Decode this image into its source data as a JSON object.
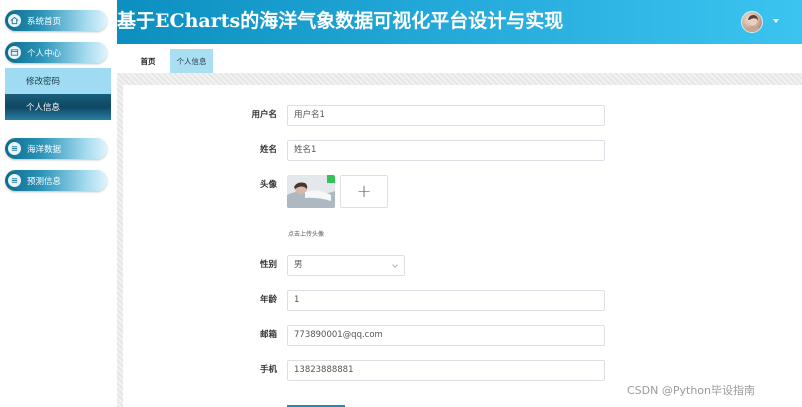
{
  "header": {
    "title": "基于ECharts的海洋气象数据可视化平台设计与实现"
  },
  "sidebar": {
    "items": [
      {
        "label": "系统首页",
        "icon": "home-icon"
      },
      {
        "label": "个人中心",
        "icon": "user-card-icon"
      },
      {
        "label": "海洋数据",
        "icon": "list-icon"
      },
      {
        "label": "预测信息",
        "icon": "list-icon"
      }
    ],
    "submenu": [
      {
        "label": "修改密码"
      },
      {
        "label": "个人信息"
      }
    ]
  },
  "tabs": [
    {
      "label": "首页"
    },
    {
      "label": "个人信息"
    }
  ],
  "form": {
    "username": {
      "label": "用户名",
      "value": "用户名1"
    },
    "name": {
      "label": "姓名",
      "value": "姓名1"
    },
    "avatar": {
      "label": "头像",
      "upload_plus": "+",
      "hint": "点击上传头像"
    },
    "gender": {
      "label": "性别",
      "value": "男"
    },
    "age": {
      "label": "年龄",
      "value": "1"
    },
    "email": {
      "label": "邮箱",
      "value": "773890001@qq.com"
    },
    "phone": {
      "label": "手机",
      "value": "13823888881"
    }
  },
  "watermark": "CSDN @Python毕设指南",
  "colors": {
    "header_start": "#0c8fc0",
    "header_end": "#3cc4f0",
    "active_tab": "#a9def3",
    "submenu_bg": "#9fdcf3"
  }
}
